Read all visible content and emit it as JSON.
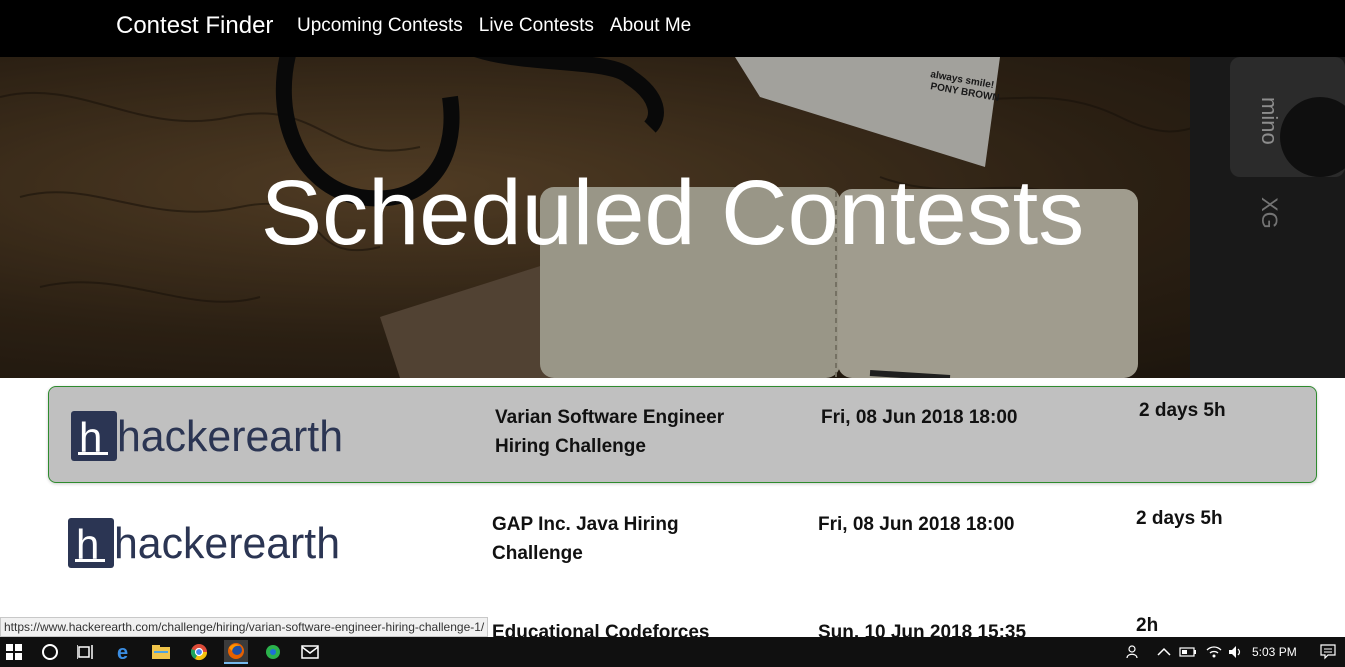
{
  "navbar": {
    "brand": "Contest Finder",
    "links": [
      "Upcoming Contests",
      "Live Contests",
      "About Me"
    ]
  },
  "hero": {
    "title": "Scheduled Contests",
    "photo_text": [
      "always smile!",
      "PONY BROWN",
      "mino",
      "XG"
    ]
  },
  "contests": [
    {
      "platform_logo_text": "hackerearth",
      "logo_icon_letter": "h",
      "name": "Varian Software Engineer Hiring Challenge",
      "start": "Fri, 08 Jun 2018 18:00",
      "duration": "2 days 5h",
      "highlighted": true
    },
    {
      "platform_logo_text": "hackerearth",
      "logo_icon_letter": "h",
      "name": "GAP Inc. Java Hiring Challenge",
      "start": "Fri, 08 Jun 2018 18:00",
      "duration": "2 days 5h",
      "highlighted": false
    },
    {
      "name": "Educational Codeforces",
      "start": "Sun, 10 Jun 2018 15:35",
      "duration": "2h",
      "highlighted": false
    }
  ],
  "status_bar": {
    "url": "https://www.hackerearth.com/challenge/hiring/varian-software-engineer-hiring-challenge-1/"
  },
  "taskbar": {
    "icons": [
      "windows-start-icon",
      "cortana-search-icon",
      "task-view-icon",
      "edge-browser-icon",
      "file-explorer-icon",
      "chrome-browser-icon",
      "firefox-browser-icon",
      "green-app-icon",
      "mail-icon"
    ],
    "tray_icons": [
      "people-icon",
      "chevron-up-icon",
      "battery-icon",
      "wifi-icon",
      "volume-icon"
    ],
    "clock": "5:03 PM",
    "notification_icon": "action-center-icon"
  },
  "colors": {
    "navbar_bg": "#000000",
    "highlight_bg": "#c0c0c0",
    "highlight_border": "#2e8b2e",
    "logo_color": "#2b3553"
  }
}
